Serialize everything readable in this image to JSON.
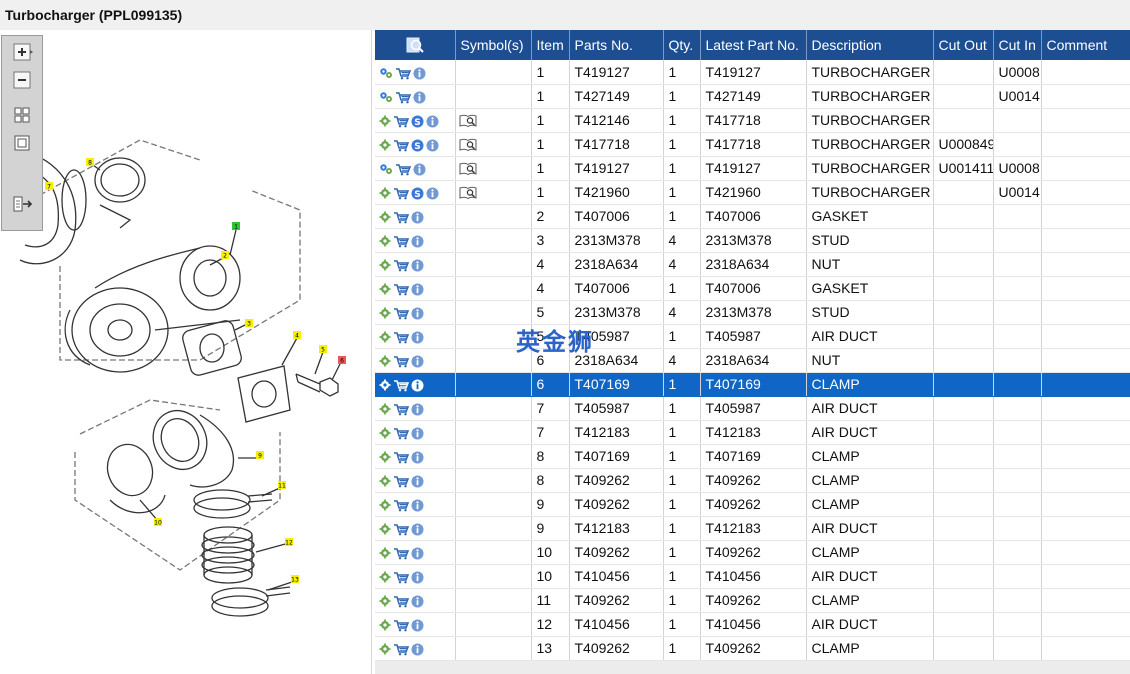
{
  "window": {
    "title": "Turbocharger (PPL099135)"
  },
  "watermark": "英金狮",
  "diagram": {
    "callouts": [
      "1",
      "2",
      "3",
      "4",
      "5",
      "6",
      "7",
      "8",
      "9",
      "10",
      "11",
      "12",
      "13"
    ],
    "tools": [
      "zoom-in-icon",
      "zoom-out-icon",
      "fit-icon",
      "actual-size-icon",
      "export-icon"
    ]
  },
  "table": {
    "columns": [
      "",
      "Symbol(s)",
      "Item",
      "Parts No.",
      "Qty.",
      "Latest Part No.",
      "Description",
      "Cut Out",
      "Cut In",
      "Comment"
    ],
    "header_icon": "search-icon",
    "rows": [
      {
        "action": "gears",
        "s": false,
        "sym": false,
        "item": "1",
        "part": "T419127",
        "qty": "1",
        "latest": "T419127",
        "desc": "TURBOCHARGER",
        "cutout": "",
        "cutin": "U0008",
        "comment": ""
      },
      {
        "action": "gears",
        "s": false,
        "sym": false,
        "item": "1",
        "part": "T427149",
        "qty": "1",
        "latest": "T427149",
        "desc": "TURBOCHARGER",
        "cutout": "",
        "cutin": "U0014",
        "comment": ""
      },
      {
        "action": "gear",
        "s": true,
        "sym": true,
        "item": "1",
        "part": "T412146",
        "qty": "1",
        "latest": "T417718",
        "desc": "TURBOCHARGER",
        "cutout": "",
        "cutin": "",
        "comment": ""
      },
      {
        "action": "gear",
        "s": true,
        "sym": true,
        "item": "1",
        "part": "T417718",
        "qty": "1",
        "latest": "T417718",
        "desc": "TURBOCHARGER",
        "cutout": "U000849",
        "cutin": "",
        "comment": ""
      },
      {
        "action": "gears",
        "s": false,
        "sym": true,
        "item": "1",
        "part": "T419127",
        "qty": "1",
        "latest": "T419127",
        "desc": "TURBOCHARGER",
        "cutout": "U001411",
        "cutin": "U0008",
        "comment": ""
      },
      {
        "action": "gear",
        "s": true,
        "sym": true,
        "item": "1",
        "part": "T421960",
        "qty": "1",
        "latest": "T421960",
        "desc": "TURBOCHARGER",
        "cutout": "",
        "cutin": "U0014",
        "comment": ""
      },
      {
        "action": "gear",
        "s": false,
        "sym": false,
        "item": "2",
        "part": "T407006",
        "qty": "1",
        "latest": "T407006",
        "desc": "GASKET",
        "cutout": "",
        "cutin": "",
        "comment": ""
      },
      {
        "action": "gear",
        "s": false,
        "sym": false,
        "item": "3",
        "part": "2313M378",
        "qty": "4",
        "latest": "2313M378",
        "desc": "STUD",
        "cutout": "",
        "cutin": "",
        "comment": ""
      },
      {
        "action": "gear",
        "s": false,
        "sym": false,
        "item": "4",
        "part": "2318A634",
        "qty": "4",
        "latest": "2318A634",
        "desc": "NUT",
        "cutout": "",
        "cutin": "",
        "comment": ""
      },
      {
        "action": "gear",
        "s": false,
        "sym": false,
        "item": "4",
        "part": "T407006",
        "qty": "1",
        "latest": "T407006",
        "desc": "GASKET",
        "cutout": "",
        "cutin": "",
        "comment": ""
      },
      {
        "action": "gear",
        "s": false,
        "sym": false,
        "item": "5",
        "part": "2313M378",
        "qty": "4",
        "latest": "2313M378",
        "desc": "STUD",
        "cutout": "",
        "cutin": "",
        "comment": ""
      },
      {
        "action": "gear",
        "s": false,
        "sym": false,
        "item": "5",
        "part": "T405987",
        "qty": "1",
        "latest": "T405987",
        "desc": "AIR DUCT",
        "cutout": "",
        "cutin": "",
        "comment": ""
      },
      {
        "action": "gear",
        "s": false,
        "sym": false,
        "item": "6",
        "part": "2318A634",
        "qty": "4",
        "latest": "2318A634",
        "desc": "NUT",
        "cutout": "",
        "cutin": "",
        "comment": ""
      },
      {
        "action": "gear",
        "s": false,
        "sym": false,
        "item": "6",
        "part": "T407169",
        "qty": "1",
        "latest": "T407169",
        "desc": "CLAMP",
        "cutout": "",
        "cutin": "",
        "comment": "",
        "selected": true
      },
      {
        "action": "gear",
        "s": false,
        "sym": false,
        "item": "7",
        "part": "T405987",
        "qty": "1",
        "latest": "T405987",
        "desc": "AIR DUCT",
        "cutout": "",
        "cutin": "",
        "comment": ""
      },
      {
        "action": "gear",
        "s": false,
        "sym": false,
        "item": "7",
        "part": "T412183",
        "qty": "1",
        "latest": "T412183",
        "desc": "AIR DUCT",
        "cutout": "",
        "cutin": "",
        "comment": ""
      },
      {
        "action": "gear",
        "s": false,
        "sym": false,
        "item": "8",
        "part": "T407169",
        "qty": "1",
        "latest": "T407169",
        "desc": "CLAMP",
        "cutout": "",
        "cutin": "",
        "comment": ""
      },
      {
        "action": "gear",
        "s": false,
        "sym": false,
        "item": "8",
        "part": "T409262",
        "qty": "1",
        "latest": "T409262",
        "desc": "CLAMP",
        "cutout": "",
        "cutin": "",
        "comment": ""
      },
      {
        "action": "gear",
        "s": false,
        "sym": false,
        "item": "9",
        "part": "T409262",
        "qty": "1",
        "latest": "T409262",
        "desc": "CLAMP",
        "cutout": "",
        "cutin": "",
        "comment": ""
      },
      {
        "action": "gear",
        "s": false,
        "sym": false,
        "item": "9",
        "part": "T412183",
        "qty": "1",
        "latest": "T412183",
        "desc": "AIR DUCT",
        "cutout": "",
        "cutin": "",
        "comment": ""
      },
      {
        "action": "gear",
        "s": false,
        "sym": false,
        "item": "10",
        "part": "T409262",
        "qty": "1",
        "latest": "T409262",
        "desc": "CLAMP",
        "cutout": "",
        "cutin": "",
        "comment": ""
      },
      {
        "action": "gear",
        "s": false,
        "sym": false,
        "item": "10",
        "part": "T410456",
        "qty": "1",
        "latest": "T410456",
        "desc": "AIR DUCT",
        "cutout": "",
        "cutin": "",
        "comment": ""
      },
      {
        "action": "gear",
        "s": false,
        "sym": false,
        "item": "11",
        "part": "T409262",
        "qty": "1",
        "latest": "T409262",
        "desc": "CLAMP",
        "cutout": "",
        "cutin": "",
        "comment": ""
      },
      {
        "action": "gear",
        "s": false,
        "sym": false,
        "item": "12",
        "part": "T410456",
        "qty": "1",
        "latest": "T410456",
        "desc": "AIR DUCT",
        "cutout": "",
        "cutin": "",
        "comment": ""
      },
      {
        "action": "gear",
        "s": false,
        "sym": false,
        "item": "13",
        "part": "T409262",
        "qty": "1",
        "latest": "T409262",
        "desc": "CLAMP",
        "cutout": "",
        "cutin": "",
        "comment": ""
      }
    ]
  },
  "colors": {
    "header": "#1c4e91",
    "selected": "#0f66c6",
    "callout": "#f4f000",
    "callout_green": "#31c531",
    "callout_red": "#e8595b"
  }
}
